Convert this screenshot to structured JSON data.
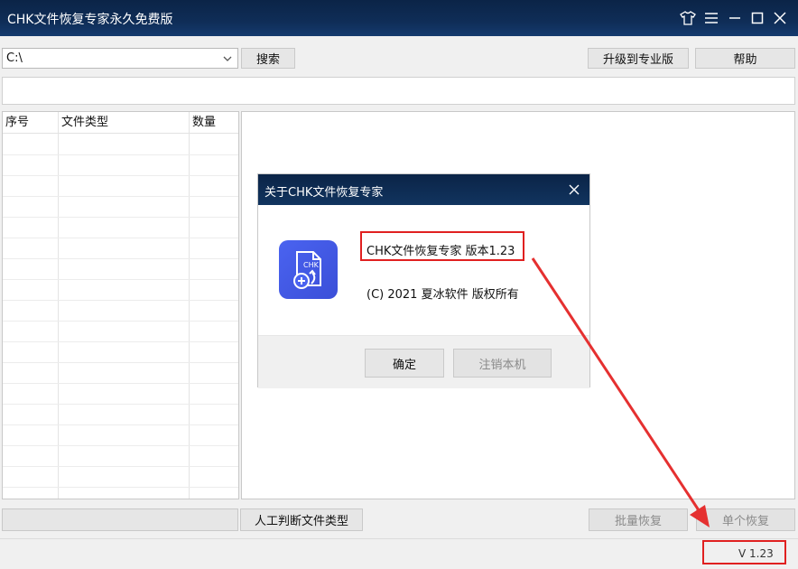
{
  "window": {
    "title": "CHK文件恢复专家永久免费版"
  },
  "toolbar": {
    "drive_value": "C:\\",
    "search_label": "搜索",
    "upgrade_label": "升级到专业版",
    "help_label": "帮助"
  },
  "table": {
    "columns": [
      "序号",
      "文件类型",
      "数量"
    ],
    "rows": []
  },
  "dialog": {
    "title": "关于CHK文件恢复专家",
    "product_line": "CHK文件恢复专家 版本1.23",
    "copyright_line": "(C) 2021 夏冰软件 版权所有",
    "ok_label": "确定",
    "unregister_label": "注销本机",
    "logo_text": "CHK"
  },
  "bottom": {
    "manual_type_label": "人工判断文件类型",
    "batch_restore_label": "批量恢复",
    "single_restore_label": "单个恢复"
  },
  "status": {
    "version": "V 1.23"
  },
  "colors": {
    "titlebar": "#0b2447",
    "highlight": "#e02020",
    "logo": "#4a63f0"
  }
}
